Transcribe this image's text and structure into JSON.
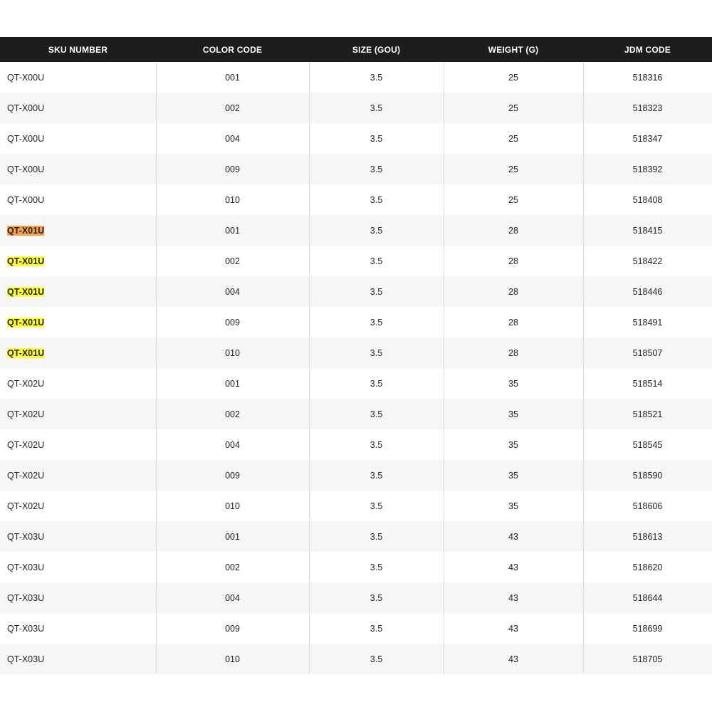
{
  "table": {
    "headers": [
      "SKU NUMBER",
      "COLOR CODE",
      "SIZE (GOU)",
      "WEIGHT (G)",
      "JDM CODE"
    ],
    "rows": [
      {
        "sku": "QT-X00U",
        "color": "001",
        "size": "3.5",
        "weight": "25",
        "jdm": "518316",
        "highlight": ""
      },
      {
        "sku": "QT-X00U",
        "color": "002",
        "size": "3.5",
        "weight": "25",
        "jdm": "518323",
        "highlight": ""
      },
      {
        "sku": "QT-X00U",
        "color": "004",
        "size": "3.5",
        "weight": "25",
        "jdm": "518347",
        "highlight": ""
      },
      {
        "sku": "QT-X00U",
        "color": "009",
        "size": "3.5",
        "weight": "25",
        "jdm": "518392",
        "highlight": ""
      },
      {
        "sku": "QT-X00U",
        "color": "010",
        "size": "3.5",
        "weight": "25",
        "jdm": "518408",
        "highlight": ""
      },
      {
        "sku": "QT-X01U",
        "color": "001",
        "size": "3.5",
        "weight": "28",
        "jdm": "518415",
        "highlight": "#f5a04a"
      },
      {
        "sku": "QT-X01U",
        "color": "002",
        "size": "3.5",
        "weight": "28",
        "jdm": "518422",
        "highlight": "#ffff33"
      },
      {
        "sku": "QT-X01U",
        "color": "004",
        "size": "3.5",
        "weight": "28",
        "jdm": "518446",
        "highlight": "#ffff33"
      },
      {
        "sku": "QT-X01U",
        "color": "009",
        "size": "3.5",
        "weight": "28",
        "jdm": "518491",
        "highlight": "#ffff33"
      },
      {
        "sku": "QT-X01U",
        "color": "010",
        "size": "3.5",
        "weight": "28",
        "jdm": "518507",
        "highlight": "#ffff33"
      },
      {
        "sku": "QT-X02U",
        "color": "001",
        "size": "3.5",
        "weight": "35",
        "jdm": "518514",
        "highlight": ""
      },
      {
        "sku": "QT-X02U",
        "color": "002",
        "size": "3.5",
        "weight": "35",
        "jdm": "518521",
        "highlight": ""
      },
      {
        "sku": "QT-X02U",
        "color": "004",
        "size": "3.5",
        "weight": "35",
        "jdm": "518545",
        "highlight": ""
      },
      {
        "sku": "QT-X02U",
        "color": "009",
        "size": "3.5",
        "weight": "35",
        "jdm": "518590",
        "highlight": ""
      },
      {
        "sku": "QT-X02U",
        "color": "010",
        "size": "3.5",
        "weight": "35",
        "jdm": "518606",
        "highlight": ""
      },
      {
        "sku": "QT-X03U",
        "color": "001",
        "size": "3.5",
        "weight": "43",
        "jdm": "518613",
        "highlight": ""
      },
      {
        "sku": "QT-X03U",
        "color": "002",
        "size": "3.5",
        "weight": "43",
        "jdm": "518620",
        "highlight": ""
      },
      {
        "sku": "QT-X03U",
        "color": "004",
        "size": "3.5",
        "weight": "43",
        "jdm": "518644",
        "highlight": ""
      },
      {
        "sku": "QT-X03U",
        "color": "009",
        "size": "3.5",
        "weight": "43",
        "jdm": "518699",
        "highlight": ""
      },
      {
        "sku": "QT-X03U",
        "color": "010",
        "size": "3.5",
        "weight": "43",
        "jdm": "518705",
        "highlight": ""
      }
    ]
  },
  "colors": {
    "header_background": "#1d1d1d",
    "header_text": "#ffffff",
    "row_stripe": "#f6f6f6",
    "highlight_orange": "#f5a04a",
    "highlight_yellow": "#ffff33"
  }
}
